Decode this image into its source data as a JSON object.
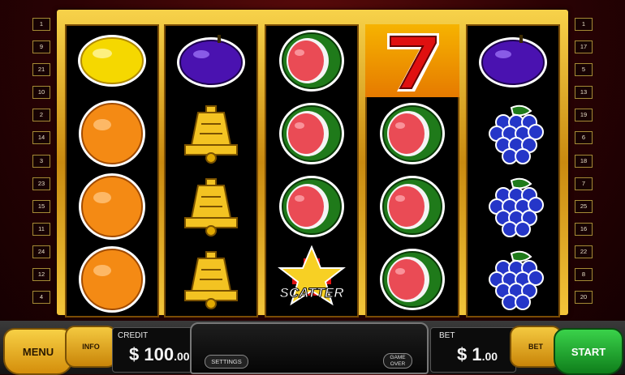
{
  "lines_left": [
    "1",
    "9",
    "21",
    "10",
    "2",
    "14",
    "3",
    "23",
    "15",
    "11",
    "24",
    "12",
    "4"
  ],
  "lines_right": [
    "1",
    "17",
    "5",
    "13",
    "19",
    "6",
    "18",
    "7",
    "25",
    "16",
    "22",
    "8",
    "20"
  ],
  "reels": [
    [
      "lemon",
      "orange",
      "orange",
      "orange"
    ],
    [
      "plum",
      "bell",
      "bell",
      "bell"
    ],
    [
      "watermelon",
      "watermelon",
      "watermelon",
      "scatter"
    ],
    [
      "seven",
      "watermelon",
      "watermelon",
      "watermelon"
    ],
    [
      "plum",
      "grapes",
      "grapes",
      "grapes"
    ]
  ],
  "scatter_label": "SCATTER",
  "console": {
    "menu_label": "MENU",
    "info_label": "INFO",
    "credit_label": "CREDIT",
    "credit_currency": "$",
    "credit_whole": "100",
    "credit_cents": ".00",
    "settings_label": "SETTINGS",
    "gameover_line1": "GAME",
    "gameover_line2": "OVER",
    "bet_label": "BET",
    "bet_currency": "$",
    "bet_whole": "1",
    "bet_cents": ".00",
    "bet_button_label": "BET",
    "start_label": "START"
  },
  "colors": {
    "frame_gold": "#f2c53a",
    "start_green": "#1fa12e",
    "win_highlight": "#f6b300"
  }
}
